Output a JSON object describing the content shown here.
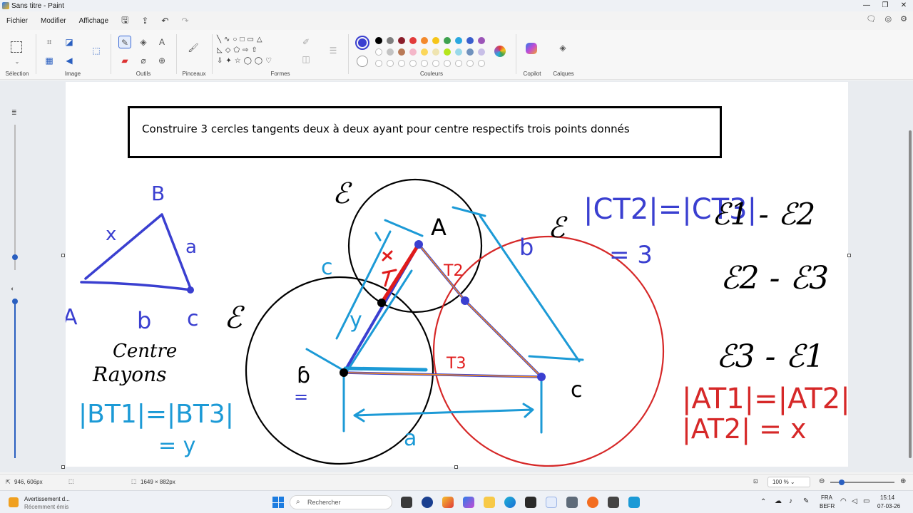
{
  "window": {
    "title": "Sans titre - Paint"
  },
  "menu": {
    "items": [
      "Fichier",
      "Modifier",
      "Affichage"
    ]
  },
  "ribbon": {
    "groups": {
      "selection": "Sélection",
      "image": "Image",
      "tools": "Outils",
      "brushes": "Pinceaux",
      "shapes": "Formes",
      "colors": "Couleurs",
      "copilot": "Copilot",
      "layers": "Calques"
    },
    "active_color": "#3a3fd0",
    "palette_row1": [
      "#000000",
      "#7f7f7f",
      "#8b1e2b",
      "#e23b3b",
      "#f3892c",
      "#f6c518",
      "#3ea24f",
      "#2aa8e0",
      "#3a5fcd",
      "#9c55b8"
    ],
    "palette_row2": [
      "#ffffff",
      "#c3c3c3",
      "#b97a57",
      "#f4b7c9",
      "#fbd75b",
      "#efe4b0",
      "#b5e61d",
      "#99d9ea",
      "#7092be",
      "#c8bfe7"
    ]
  },
  "canvas": {
    "instruction": "Construire 3 cercles tangents deux à deux ayant pour centre respectifs trois points donnés"
  },
  "status": {
    "cursor": "946, 606px",
    "canvas_size": "1649 × 882px",
    "zoom": "100 %"
  },
  "taskbar": {
    "notification_title": "Avertissement d...",
    "notification_sub": "Récemment émis",
    "search_placeholder": "Rechercher",
    "lang": "FRA",
    "layout": "BEFR",
    "time": "15:14",
    "date": "07-03-26"
  }
}
